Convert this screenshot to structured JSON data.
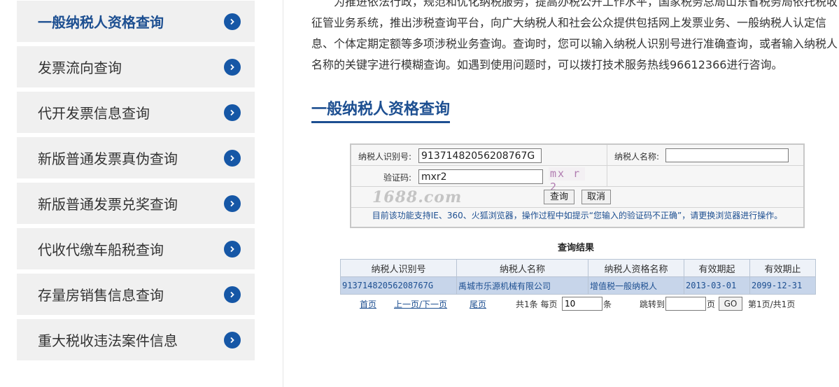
{
  "sidebar": {
    "items": [
      {
        "label": "一般纳税人资格查询",
        "active": true
      },
      {
        "label": "发票流向查询"
      },
      {
        "label": "代开发票信息查询"
      },
      {
        "label": "新版普通发票真伪查询"
      },
      {
        "label": "新版普通发票兑奖查询"
      },
      {
        "label": "代收代缴车船税查询"
      },
      {
        "label": "存量房销售信息查询"
      },
      {
        "label": "重大税收违法案件信息"
      }
    ]
  },
  "intro": {
    "lines": [
      "为推进依法行政，规范和优化纳税服务，提高办税公开工作水平，国家税务总局山东省税务局依托税收",
      "征管业务系统，推出涉税查询平台，向广大纳税人和社会公众提供包括网上发票业务、一般纳税人认定信",
      "息、个体定期定额等多项涉税业务查询。查询时，您可以输入纳税人识别号进行准确查询，或者输入纳税人",
      "名称的关键字进行模糊查询。如遇到使用问题时，可以拨打技术服务热线96612366进行咨询。"
    ]
  },
  "section_title": "一般纳税人资格查询",
  "form": {
    "taxpayer_id_label": "纳税人识别号:",
    "taxpayer_id_value": "91371482056208767G",
    "taxpayer_name_label": "纳税人名称:",
    "taxpayer_name_value": "",
    "captcha_label": "验证码:",
    "captcha_value": "mxr2",
    "captcha_image_text": "mx r 2",
    "watermark": "1688.com",
    "query_button": "查询",
    "cancel_button": "取消",
    "notice": "目前该功能支持IE、360、火狐浏览器，操作过程中如提示“您输入的验证码不正确”，请更换浏览器进行操作。"
  },
  "results": {
    "title": "查询结果",
    "columns": [
      "纳税人识别号",
      "纳税人名称",
      "纳税人资格名称",
      "有效期起",
      "有效期止"
    ],
    "rows": [
      [
        "91371482056208767G",
        "禹城市乐源机械有限公司",
        "增值税一般纳税人",
        "2013-03-01",
        "2099-12-31"
      ]
    ]
  },
  "pager": {
    "first": "首页",
    "prev_next": "上一页/下一页",
    "last": "尾页",
    "total_prefix": "共1条 每页",
    "per_page": "10",
    "per_page_unit": "条",
    "jump_label": "跳转到",
    "jump_value": "",
    "page_unit": "页",
    "go": "GO",
    "page_info": "第1页/共1页"
  },
  "colors": {
    "accent": "#1d4f91",
    "arrow": "#1657a6",
    "row_bg": "#c7d5ea"
  },
  "icons": {
    "arrow": "chevron-right-circle-icon"
  }
}
